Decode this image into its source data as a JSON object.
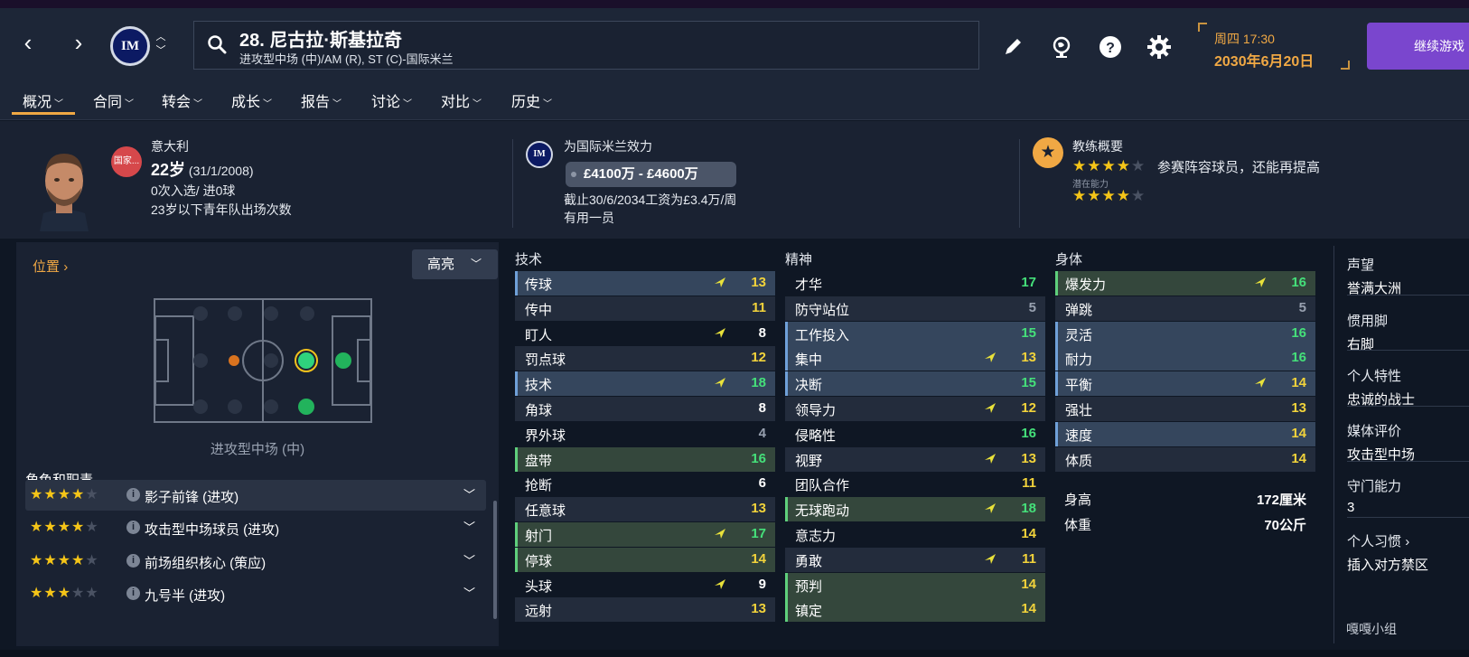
{
  "app": {
    "accent": "#f0a844",
    "continue_color": "#7a46ce"
  },
  "topbar": {
    "back_icon": "chevron-left-icon",
    "forward_icon": "chevron-right-icon",
    "club_badge_text": "IM",
    "player_title": "28. 尼古拉·斯基拉奇",
    "player_subtitle": "进攻型中场 (中)/AM (R), ST (C)-国际米兰",
    "day_time": "周四 17:30",
    "date": "2030年6月20日",
    "continue_label": "继续游戏"
  },
  "tabs": [
    {
      "label": "概况"
    },
    {
      "label": "合同"
    },
    {
      "label": "转会"
    },
    {
      "label": "成长"
    },
    {
      "label": "报告"
    },
    {
      "label": "讨论"
    },
    {
      "label": "对比"
    },
    {
      "label": "历史"
    }
  ],
  "header": {
    "nation_label": "国家...",
    "nation": "意大利",
    "age_big": "22岁",
    "birth": "(31/1/2008)",
    "caps": "0次入选/ 进0球",
    "youth": "23岁以下青年队出场次数",
    "club_badge": "IM",
    "plays_for": "为国际米兰效力",
    "value": "£4100万 - £4600万",
    "contract": "截止30/6/2034工资为£3.4万/周",
    "role_status": "有用一员",
    "coach_title": "教练概要",
    "coach_summary": "参赛阵容球员，还能再提高",
    "potential_label": "潜在能力",
    "current_stars": 4,
    "potential_stars": 4
  },
  "left": {
    "position_link": "位置",
    "highlight": "高亮",
    "position_caption": "进攻型中场 (中)",
    "roles_heading": "角色和职责",
    "roles": [
      {
        "name": "影子前锋 (进攻)",
        "stars": 4
      },
      {
        "name": "攻击型中场球员 (进攻)",
        "stars": 4
      },
      {
        "name": "前场组织核心 (策应)",
        "stars": 4
      },
      {
        "name": "九号半 (进攻)",
        "stars": 3
      }
    ]
  },
  "attributes": {
    "technical": {
      "title": "技术",
      "rows": [
        {
          "n": "传球",
          "v": "13",
          "c": "yellow",
          "hl": "blue",
          "up": true
        },
        {
          "n": "传中",
          "v": "11",
          "c": "yellow",
          "hl": "",
          "up": false
        },
        {
          "n": "盯人",
          "v": "8",
          "c": "white",
          "hl": "",
          "up": true
        },
        {
          "n": "罚点球",
          "v": "12",
          "c": "yellow",
          "hl": "",
          "up": false
        },
        {
          "n": "技术",
          "v": "18",
          "c": "green",
          "hl": "blue",
          "up": true
        },
        {
          "n": "角球",
          "v": "8",
          "c": "white",
          "hl": "",
          "up": false
        },
        {
          "n": "界外球",
          "v": "4",
          "c": "grey",
          "hl": "",
          "up": false
        },
        {
          "n": "盘带",
          "v": "16",
          "c": "green",
          "hl": "green",
          "up": false
        },
        {
          "n": "抢断",
          "v": "6",
          "c": "white",
          "hl": "",
          "up": false
        },
        {
          "n": "任意球",
          "v": "13",
          "c": "yellow",
          "hl": "",
          "up": false
        },
        {
          "n": "射门",
          "v": "17",
          "c": "green",
          "hl": "green",
          "up": true
        },
        {
          "n": "停球",
          "v": "14",
          "c": "yellow",
          "hl": "green",
          "up": false
        },
        {
          "n": "头球",
          "v": "9",
          "c": "white",
          "hl": "",
          "up": true
        },
        {
          "n": "远射",
          "v": "13",
          "c": "yellow",
          "hl": "",
          "up": false
        }
      ]
    },
    "mental": {
      "title": "精神",
      "rows": [
        {
          "n": "才华",
          "v": "17",
          "c": "green",
          "hl": "",
          "up": false
        },
        {
          "n": "防守站位",
          "v": "5",
          "c": "grey",
          "hl": "",
          "up": false
        },
        {
          "n": "工作投入",
          "v": "15",
          "c": "green",
          "hl": "blue",
          "up": false
        },
        {
          "n": "集中",
          "v": "13",
          "c": "yellow",
          "hl": "blue",
          "up": true
        },
        {
          "n": "决断",
          "v": "15",
          "c": "green",
          "hl": "blue",
          "up": false
        },
        {
          "n": "领导力",
          "v": "12",
          "c": "yellow",
          "hl": "",
          "up": true
        },
        {
          "n": "侵略性",
          "v": "16",
          "c": "green",
          "hl": "",
          "up": false
        },
        {
          "n": "视野",
          "v": "13",
          "c": "yellow",
          "hl": "",
          "up": true
        },
        {
          "n": "团队合作",
          "v": "11",
          "c": "yellow",
          "hl": "",
          "up": false
        },
        {
          "n": "无球跑动",
          "v": "18",
          "c": "green",
          "hl": "green",
          "up": true
        },
        {
          "n": "意志力",
          "v": "14",
          "c": "yellow",
          "hl": "",
          "up": false
        },
        {
          "n": "勇敢",
          "v": "11",
          "c": "yellow",
          "hl": "",
          "up": true
        },
        {
          "n": "预判",
          "v": "14",
          "c": "yellow",
          "hl": "green",
          "up": false
        },
        {
          "n": "镇定",
          "v": "14",
          "c": "yellow",
          "hl": "green",
          "up": false
        }
      ]
    },
    "physical": {
      "title": "身体",
      "rows": [
        {
          "n": "爆发力",
          "v": "16",
          "c": "green",
          "hl": "green",
          "up": true
        },
        {
          "n": "弹跳",
          "v": "5",
          "c": "grey",
          "hl": "",
          "up": false
        },
        {
          "n": "灵活",
          "v": "16",
          "c": "green",
          "hl": "blue",
          "up": false
        },
        {
          "n": "耐力",
          "v": "16",
          "c": "green",
          "hl": "blue",
          "up": false
        },
        {
          "n": "平衡",
          "v": "14",
          "c": "yellow",
          "hl": "blue",
          "up": true
        },
        {
          "n": "强壮",
          "v": "13",
          "c": "yellow",
          "hl": "",
          "up": false
        },
        {
          "n": "速度",
          "v": "14",
          "c": "yellow",
          "hl": "blue",
          "up": false
        },
        {
          "n": "体质",
          "v": "14",
          "c": "yellow",
          "hl": "",
          "up": false
        }
      ]
    },
    "height_label": "身高",
    "height": "172厘米",
    "weight_label": "体重",
    "weight": "70公斤"
  },
  "right": {
    "reputation_label": "声望",
    "reputation": "誉满大洲",
    "foot_label": "惯用脚",
    "foot": "右脚",
    "personality_label": "个人特性",
    "personality": "忠诚的战士",
    "media_label": "媒体评价",
    "media": "攻击型中场",
    "gk_label": "守门能力",
    "gk": "3",
    "habits_label": "个人习惯",
    "habit": "插入对方禁区"
  },
  "watermark": "嘎嘎小组"
}
